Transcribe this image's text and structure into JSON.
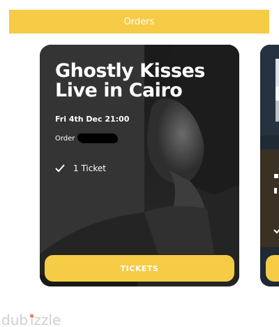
{
  "header": {
    "orders_label": "Orders"
  },
  "card": {
    "title": "Ghostly Kisses Live in Cairo",
    "date": "Fri 4th Dec 21:00",
    "order_label": "Order",
    "ticket_count": "1 Ticket",
    "tickets_button": "TICKETS"
  },
  "watermark": {
    "text": "dubizzle"
  },
  "icons": [
    "check-icon",
    "redaction-mark",
    "watermark-logo"
  ],
  "colors": {
    "accent": "#f6cb45",
    "card_bg": "#2e2e2e",
    "text": "#ffffff"
  }
}
